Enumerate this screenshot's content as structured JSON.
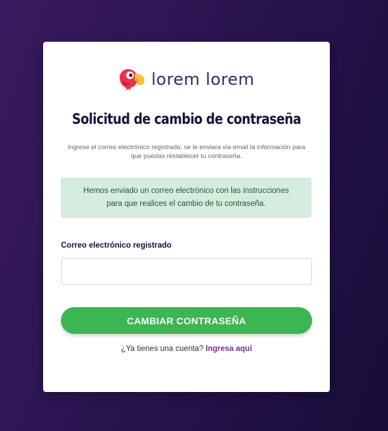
{
  "brand": {
    "name": "lorem lorem",
    "logo_icon": "parrot-logo-icon",
    "text_color": "#3b2a5c"
  },
  "title": "Solicitud de cambio de contraseña",
  "subtitle": "Ingrese el correo electrónico registrado, se le enviara via email la información para que puedas restablecer tu contraseña.",
  "alert": {
    "message": "Hemos enviado un correo electrónico con las instrucciones para que realices el cambio de tu contraseña.",
    "type": "success",
    "background": "#d5ecdf",
    "text_color": "#1d5b38"
  },
  "form": {
    "email_label": "Correo electrónico registrado",
    "email_value": "",
    "email_placeholder": ""
  },
  "submit": {
    "label": "CAMBIAR CONTRASEÑA",
    "color": "#3cb553"
  },
  "footer": {
    "prompt": "¿Ya tienes una cuenta?",
    "link_label": "Ingresa aquí",
    "link_color": "#7b2d8e"
  },
  "background": {
    "gradient_start": "#3a1a5e",
    "gradient_end": "#170d38"
  }
}
